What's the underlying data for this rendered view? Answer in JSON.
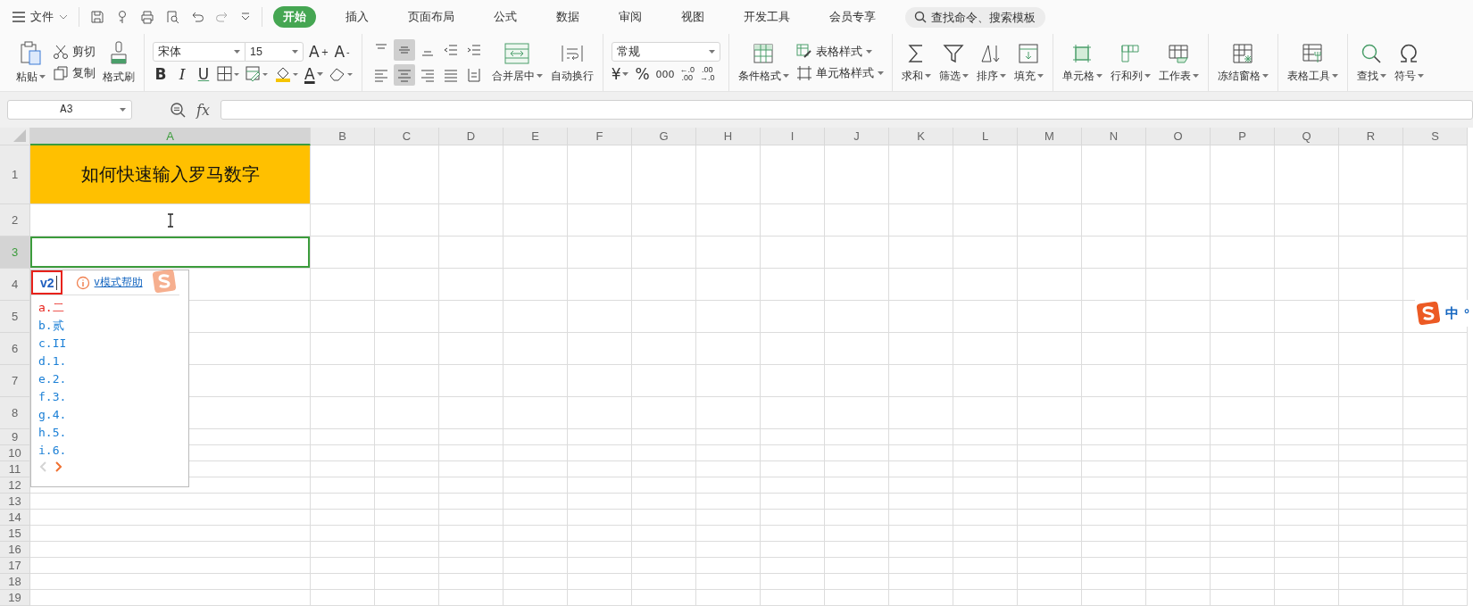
{
  "title_bar": {
    "file_menu": "文件",
    "tabs": [
      {
        "label": "开始",
        "selected": true
      },
      {
        "label": "插入",
        "selected": false
      },
      {
        "label": "页面布局",
        "selected": false
      },
      {
        "label": "公式",
        "selected": false
      },
      {
        "label": "数据",
        "selected": false
      },
      {
        "label": "审阅",
        "selected": false
      },
      {
        "label": "视图",
        "selected": false
      },
      {
        "label": "开发工具",
        "selected": false
      },
      {
        "label": "会员专享",
        "selected": false
      }
    ],
    "search": {
      "placeholder": "查找命令、搜索模板"
    }
  },
  "ribbon": {
    "paste": "粘贴",
    "cut": "剪切",
    "copy": "复制",
    "format_painter": "格式刷",
    "font_name": "宋体",
    "font_size": "15",
    "grow_font": "A$^{+}$",
    "shrink_font": "A$^{-}$",
    "bold": "B",
    "italic": "I",
    "underline": "U",
    "font_color": "A",
    "align_buttons": [
      {
        "selected": false
      },
      {
        "selected": true
      },
      {
        "selected": false
      },
      {
        "selected": false
      },
      {
        "selected": false
      },
      {
        "selected": false
      },
      {
        "selected": true
      },
      {
        "selected": false
      },
      {
        "selected": false
      },
      {
        "selected": false
      }
    ],
    "merge": "合并居中",
    "wrap": "自动换行",
    "number_format": "常规",
    "currency": "¥",
    "percent": "%",
    "thousands": "000",
    "increase_decimal": {
      "top": "←.0",
      "bottom": ".00"
    },
    "decrease_decimal": {
      "top": ".00",
      "bottom": "→.0"
    },
    "conditional_format": "条件格式",
    "table_style": "表格样式",
    "cell_style": "单元格样式",
    "edit_group": [
      "求和",
      "筛选",
      "排序",
      "填充"
    ],
    "cells_group": [
      "单元格",
      "行和列",
      "工作表"
    ],
    "freeze": "冻结窗格",
    "table_tools": "表格工具",
    "find_group": [
      "查找",
      "符号"
    ]
  },
  "formula_bar": {
    "name_box": "A3",
    "fx": "fx"
  },
  "sheet": {
    "columns": [
      {
        "label": "A",
        "selected": true
      },
      {
        "label": "B",
        "selected": false
      },
      {
        "label": "C",
        "selected": false
      },
      {
        "label": "D",
        "selected": false
      },
      {
        "label": "E",
        "selected": false
      },
      {
        "label": "F",
        "selected": false
      },
      {
        "label": "G",
        "selected": false
      },
      {
        "label": "H",
        "selected": false
      },
      {
        "label": "I",
        "selected": false
      },
      {
        "label": "J",
        "selected": false
      },
      {
        "label": "K",
        "selected": false
      },
      {
        "label": "L",
        "selected": false
      },
      {
        "label": "M",
        "selected": false
      },
      {
        "label": "N",
        "selected": false
      },
      {
        "label": "O",
        "selected": false
      },
      {
        "label": "P",
        "selected": false
      },
      {
        "label": "Q",
        "selected": false
      },
      {
        "label": "R",
        "selected": false
      },
      {
        "label": "S",
        "selected": false
      }
    ],
    "rows": [
      {
        "label": "1",
        "selected": false
      },
      {
        "label": "2",
        "selected": false
      },
      {
        "label": "3",
        "selected": true
      },
      {
        "label": "4",
        "selected": false
      },
      {
        "label": "5",
        "selected": false
      },
      {
        "label": "6",
        "selected": false
      },
      {
        "label": "7",
        "selected": false
      },
      {
        "label": "8",
        "selected": false
      },
      {
        "label": "9",
        "selected": false
      },
      {
        "label": "10",
        "selected": false
      },
      {
        "label": "11",
        "selected": false
      },
      {
        "label": "12",
        "selected": false
      },
      {
        "label": "13",
        "selected": false
      },
      {
        "label": "14",
        "selected": false
      },
      {
        "label": "15",
        "selected": false
      },
      {
        "label": "16",
        "selected": false
      },
      {
        "label": "17",
        "selected": false
      },
      {
        "label": "18",
        "selected": false
      },
      {
        "label": "19",
        "selected": false
      }
    ],
    "cell_a1": "如何快速输入罗马数字"
  },
  "ime": {
    "input": "v2",
    "help_link": "v模式帮助",
    "candidates": [
      {
        "text": "a.二",
        "selected": true
      },
      {
        "text": "b.贰",
        "selected": false
      },
      {
        "text": "c.II",
        "selected": false
      },
      {
        "text": "d.1.",
        "selected": false
      },
      {
        "text": "e.2.",
        "selected": false
      },
      {
        "text": "f.3.",
        "selected": false
      },
      {
        "text": "g.4.",
        "selected": false
      },
      {
        "text": "h.5.",
        "selected": false
      },
      {
        "text": "i.6.",
        "selected": false
      }
    ],
    "prev_disabled": true,
    "next_disabled": false
  },
  "ime_status": {
    "mode": "中",
    "punctuation": "°"
  }
}
